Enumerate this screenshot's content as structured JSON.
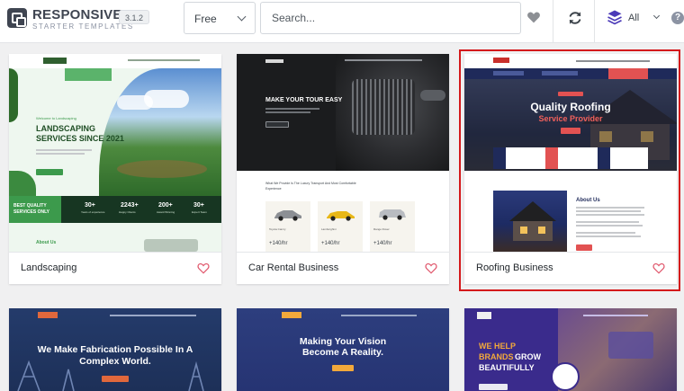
{
  "app": {
    "logo_title": "RESPONSIVE",
    "logo_subtitle": "STARTER TEMPLATES",
    "version": "3.1.2"
  },
  "filters": {
    "pricing_selected": "Free",
    "search_placeholder": "Search...",
    "type_selected": "All",
    "help_glyph": "?"
  },
  "colors": {
    "selection": "#d4191b",
    "heart_outline": "#e0556a"
  },
  "templates": [
    {
      "name": "Landscaping",
      "preview": {
        "eyebrow": "Welcome to Landscaping",
        "headline": [
          "LANDSCAPING",
          "SERVICES SINCE 2021"
        ],
        "badge": [
          "BEST QUALITY",
          "SERVICES ONLY"
        ],
        "stats": [
          {
            "value": "30+",
            "label": "Years of experience"
          },
          {
            "value": "2243+",
            "label": "Happy Clients"
          },
          {
            "value": "200+",
            "label": "Award Winning"
          },
          {
            "value": "30+",
            "label": "Expert Team"
          }
        ],
        "about": "About Us"
      }
    },
    {
      "name": "Car Rental Business",
      "preview": {
        "headline": "MAKE YOUR TOUR EASY",
        "section_title": [
          "What We Provide Is The Luxury Transport And Most Comfortable",
          "Experience"
        ],
        "cars": [
          {
            "name": "Toyota Camry",
            "price": "+140/hr"
          },
          {
            "name": "Lamborghini",
            "price": "+140/hr"
          },
          {
            "name": "Range Rover",
            "price": "+140/hr"
          }
        ]
      }
    },
    {
      "name": "Roofing Business",
      "preview": {
        "headline": "Quality Roofing",
        "subheadline": "Service Provider",
        "about": "About Us"
      }
    },
    {
      "name": "",
      "preview": {
        "headline": [
          "We Make Fabrication Possible In A",
          "Complex World."
        ]
      }
    },
    {
      "name": "",
      "preview": {
        "headline": [
          "Making Your Vision",
          "Become A Reality."
        ]
      }
    },
    {
      "name": "",
      "preview": {
        "headline": [
          "WE HELP",
          "BRANDS",
          "GROW",
          "BEAUTIFULLY"
        ]
      }
    }
  ]
}
